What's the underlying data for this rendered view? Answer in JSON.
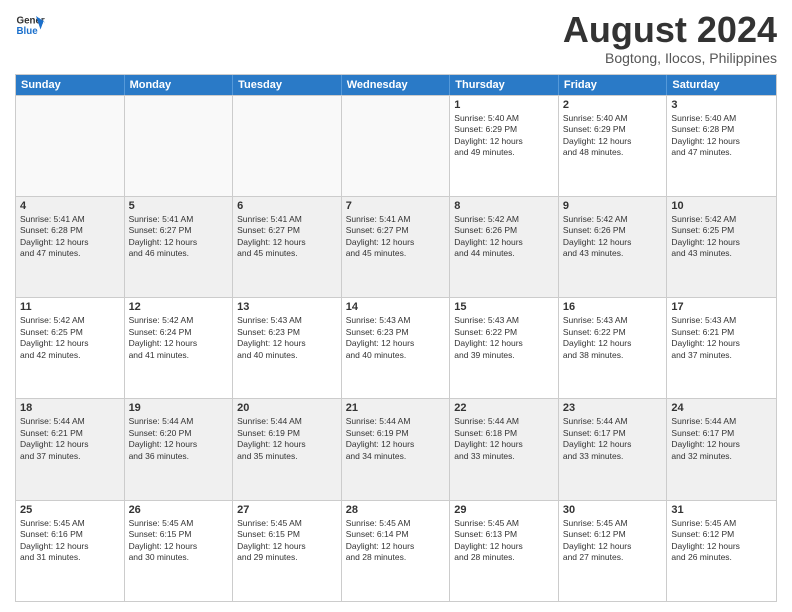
{
  "logo": {
    "line1": "General",
    "line2": "Blue"
  },
  "title": "August 2024",
  "subtitle": "Bogtong, Ilocos, Philippines",
  "days": [
    "Sunday",
    "Monday",
    "Tuesday",
    "Wednesday",
    "Thursday",
    "Friday",
    "Saturday"
  ],
  "rows": [
    [
      {
        "day": "",
        "info": "",
        "empty": true
      },
      {
        "day": "",
        "info": "",
        "empty": true
      },
      {
        "day": "",
        "info": "",
        "empty": true
      },
      {
        "day": "",
        "info": "",
        "empty": true
      },
      {
        "day": "1",
        "info": "Sunrise: 5:40 AM\nSunset: 6:29 PM\nDaylight: 12 hours\nand 49 minutes."
      },
      {
        "day": "2",
        "info": "Sunrise: 5:40 AM\nSunset: 6:29 PM\nDaylight: 12 hours\nand 48 minutes."
      },
      {
        "day": "3",
        "info": "Sunrise: 5:40 AM\nSunset: 6:28 PM\nDaylight: 12 hours\nand 47 minutes."
      }
    ],
    [
      {
        "day": "4",
        "info": "Sunrise: 5:41 AM\nSunset: 6:28 PM\nDaylight: 12 hours\nand 47 minutes.",
        "shaded": true
      },
      {
        "day": "5",
        "info": "Sunrise: 5:41 AM\nSunset: 6:27 PM\nDaylight: 12 hours\nand 46 minutes.",
        "shaded": true
      },
      {
        "day": "6",
        "info": "Sunrise: 5:41 AM\nSunset: 6:27 PM\nDaylight: 12 hours\nand 45 minutes.",
        "shaded": true
      },
      {
        "day": "7",
        "info": "Sunrise: 5:41 AM\nSunset: 6:27 PM\nDaylight: 12 hours\nand 45 minutes.",
        "shaded": true
      },
      {
        "day": "8",
        "info": "Sunrise: 5:42 AM\nSunset: 6:26 PM\nDaylight: 12 hours\nand 44 minutes.",
        "shaded": true
      },
      {
        "day": "9",
        "info": "Sunrise: 5:42 AM\nSunset: 6:26 PM\nDaylight: 12 hours\nand 43 minutes.",
        "shaded": true
      },
      {
        "day": "10",
        "info": "Sunrise: 5:42 AM\nSunset: 6:25 PM\nDaylight: 12 hours\nand 43 minutes.",
        "shaded": true
      }
    ],
    [
      {
        "day": "11",
        "info": "Sunrise: 5:42 AM\nSunset: 6:25 PM\nDaylight: 12 hours\nand 42 minutes."
      },
      {
        "day": "12",
        "info": "Sunrise: 5:42 AM\nSunset: 6:24 PM\nDaylight: 12 hours\nand 41 minutes."
      },
      {
        "day": "13",
        "info": "Sunrise: 5:43 AM\nSunset: 6:23 PM\nDaylight: 12 hours\nand 40 minutes."
      },
      {
        "day": "14",
        "info": "Sunrise: 5:43 AM\nSunset: 6:23 PM\nDaylight: 12 hours\nand 40 minutes."
      },
      {
        "day": "15",
        "info": "Sunrise: 5:43 AM\nSunset: 6:22 PM\nDaylight: 12 hours\nand 39 minutes."
      },
      {
        "day": "16",
        "info": "Sunrise: 5:43 AM\nSunset: 6:22 PM\nDaylight: 12 hours\nand 38 minutes."
      },
      {
        "day": "17",
        "info": "Sunrise: 5:43 AM\nSunset: 6:21 PM\nDaylight: 12 hours\nand 37 minutes."
      }
    ],
    [
      {
        "day": "18",
        "info": "Sunrise: 5:44 AM\nSunset: 6:21 PM\nDaylight: 12 hours\nand 37 minutes.",
        "shaded": true
      },
      {
        "day": "19",
        "info": "Sunrise: 5:44 AM\nSunset: 6:20 PM\nDaylight: 12 hours\nand 36 minutes.",
        "shaded": true
      },
      {
        "day": "20",
        "info": "Sunrise: 5:44 AM\nSunset: 6:19 PM\nDaylight: 12 hours\nand 35 minutes.",
        "shaded": true
      },
      {
        "day": "21",
        "info": "Sunrise: 5:44 AM\nSunset: 6:19 PM\nDaylight: 12 hours\nand 34 minutes.",
        "shaded": true
      },
      {
        "day": "22",
        "info": "Sunrise: 5:44 AM\nSunset: 6:18 PM\nDaylight: 12 hours\nand 33 minutes.",
        "shaded": true
      },
      {
        "day": "23",
        "info": "Sunrise: 5:44 AM\nSunset: 6:17 PM\nDaylight: 12 hours\nand 33 minutes.",
        "shaded": true
      },
      {
        "day": "24",
        "info": "Sunrise: 5:44 AM\nSunset: 6:17 PM\nDaylight: 12 hours\nand 32 minutes.",
        "shaded": true
      }
    ],
    [
      {
        "day": "25",
        "info": "Sunrise: 5:45 AM\nSunset: 6:16 PM\nDaylight: 12 hours\nand 31 minutes."
      },
      {
        "day": "26",
        "info": "Sunrise: 5:45 AM\nSunset: 6:15 PM\nDaylight: 12 hours\nand 30 minutes."
      },
      {
        "day": "27",
        "info": "Sunrise: 5:45 AM\nSunset: 6:15 PM\nDaylight: 12 hours\nand 29 minutes."
      },
      {
        "day": "28",
        "info": "Sunrise: 5:45 AM\nSunset: 6:14 PM\nDaylight: 12 hours\nand 28 minutes."
      },
      {
        "day": "29",
        "info": "Sunrise: 5:45 AM\nSunset: 6:13 PM\nDaylight: 12 hours\nand 28 minutes."
      },
      {
        "day": "30",
        "info": "Sunrise: 5:45 AM\nSunset: 6:12 PM\nDaylight: 12 hours\nand 27 minutes."
      },
      {
        "day": "31",
        "info": "Sunrise: 5:45 AM\nSunset: 6:12 PM\nDaylight: 12 hours\nand 26 minutes."
      }
    ]
  ]
}
